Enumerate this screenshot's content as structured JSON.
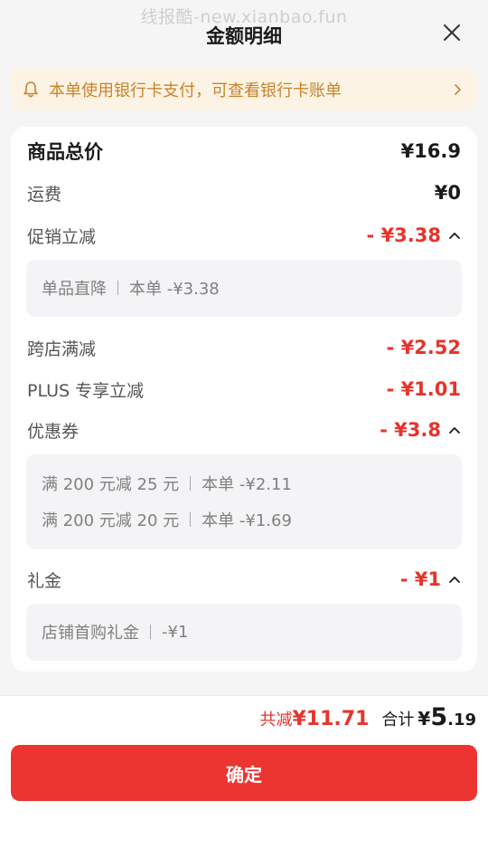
{
  "watermark": "线报酷-new.xianbao.fun",
  "header": {
    "title": "金额明细",
    "close_icon": "close-icon"
  },
  "notice": {
    "text": "本单使用银行卡支付，可查看银行卡账单",
    "icon": "bell-icon",
    "accent": "#c8832a"
  },
  "items": {
    "total": {
      "label": "商品总价",
      "value": "¥16.9"
    },
    "shipping": {
      "label": "运费",
      "value": "¥0"
    },
    "promo": {
      "label": "促销立减",
      "value": "- ¥3.38",
      "details": [
        {
          "name": "单品直降",
          "value": "本单 -¥3.38"
        }
      ]
    },
    "cross_store": {
      "label": "跨店满减",
      "value": "- ¥2.52"
    },
    "plus": {
      "label": "PLUS 专享立减",
      "value": "- ¥1.01"
    },
    "coupon": {
      "label": "优惠券",
      "value": "- ¥3.8",
      "details": [
        {
          "name": "满 200 元减 25 元",
          "value": "本单 -¥2.11"
        },
        {
          "name": "满 200 元减 20 元",
          "value": "本单 -¥1.69"
        }
      ]
    },
    "gift": {
      "label": "礼金",
      "value": "- ¥1",
      "details": [
        {
          "name": "店铺首购礼金",
          "value": "-¥1"
        }
      ]
    }
  },
  "summary": {
    "discount_label": "共减",
    "discount_value": "¥11.71",
    "total_label": "合计",
    "total_currency": "¥",
    "total_int": "5",
    "total_dec": ".19"
  },
  "confirm_label": "确定",
  "colors": {
    "red": "#e5342c",
    "button": "#ec3430",
    "notice_bg": "#fdf3e4"
  }
}
